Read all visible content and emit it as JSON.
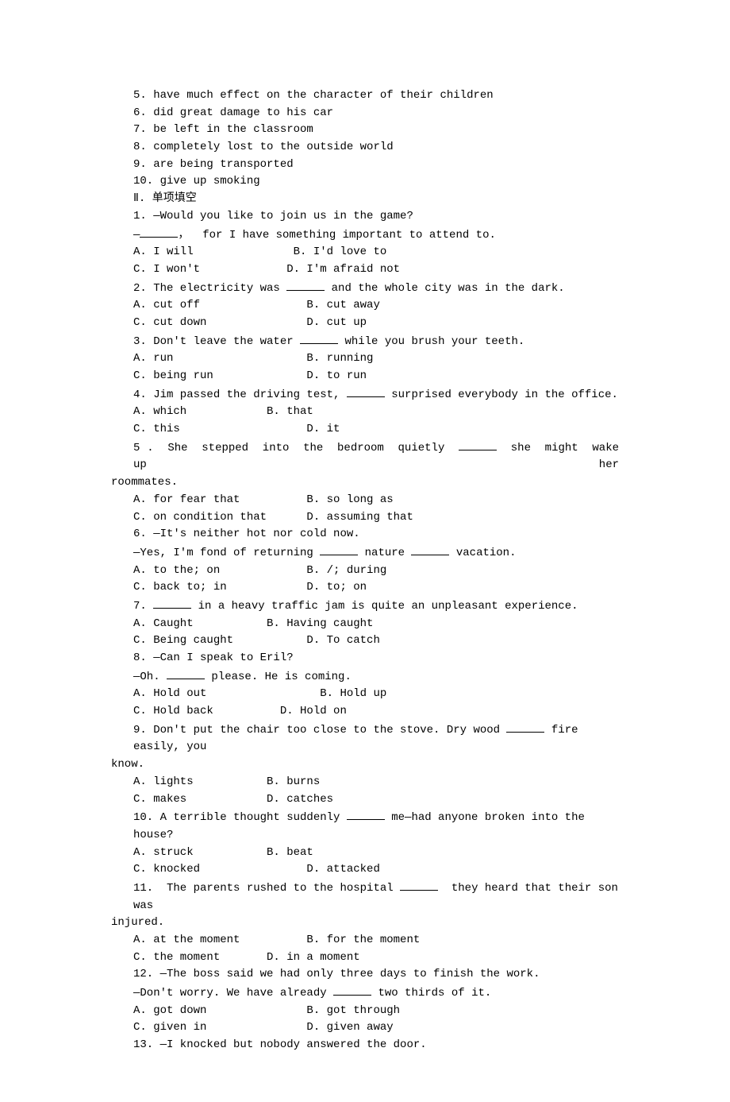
{
  "lines": [
    {
      "cls": "indent1",
      "text": "5. have much effect on the character of their children"
    },
    {
      "cls": "indent1",
      "text": "6. did great damage to his car"
    },
    {
      "cls": "indent1",
      "text": "7. be left in the classroom"
    },
    {
      "cls": "indent1",
      "text": "8. completely lost to the outside world"
    },
    {
      "cls": "indent1",
      "text": "9. are being transported"
    },
    {
      "cls": "indent1",
      "text": "10. give up smoking"
    },
    {
      "cls": "indent1",
      "text": "Ⅱ. 单项填空"
    },
    {
      "cls": "indent1",
      "text": "1. —Would you like to join us in the game?"
    },
    {
      "cls": "indent1",
      "parts": [
        "—",
        "BLANK",
        "，  for I have something important to attend to."
      ]
    },
    {
      "cls": "indent1",
      "text": "A. I will               B. I'd love to"
    },
    {
      "cls": "indent1",
      "text": "C. I won't             D. I'm afraid not"
    },
    {
      "cls": "indent1",
      "parts": [
        "2. The electricity was ",
        "BLANK",
        " and the whole city was in the dark."
      ]
    },
    {
      "cls": "indent1",
      "text": "A. cut off                B. cut away"
    },
    {
      "cls": "indent1",
      "text": "C. cut down               D. cut up"
    },
    {
      "cls": "indent1",
      "parts": [
        "3. Don't leave the water ",
        "BLANK",
        " while you brush your teeth."
      ]
    },
    {
      "cls": "indent1",
      "text": "A. run                    B. running"
    },
    {
      "cls": "indent1",
      "text": "C. being run              D. to run"
    },
    {
      "cls": "indent1",
      "parts": [
        "4. Jim passed the driving test, ",
        "BLANK",
        " surprised everybody in the office."
      ]
    },
    {
      "cls": "indent1",
      "text": "A. which            B. that"
    },
    {
      "cls": "indent1",
      "text": "C. this                   D. it"
    },
    {
      "cls": "indent1 justify",
      "parts": [
        "5 .  She  stepped  into  the  bedroom  quietly  ",
        "BLANK",
        "  she  might  wake  up  her"
      ]
    },
    {
      "cls": "wrap-indent",
      "text": "roommates."
    },
    {
      "cls": "indent1",
      "text": "A. for fear that          B. so long as"
    },
    {
      "cls": "indent1",
      "text": "C. on condition that      D. assuming that"
    },
    {
      "cls": "indent1",
      "text": "6. —It's neither hot nor cold now."
    },
    {
      "cls": "indent1",
      "parts": [
        "—Yes, I'm fond of returning ",
        "BLANK",
        " nature ",
        "BLANK",
        " vacation."
      ]
    },
    {
      "cls": "indent1",
      "text": "A. to the; on             B. /; during"
    },
    {
      "cls": "indent1",
      "text": "C. back to; in            D. to; on"
    },
    {
      "cls": "indent1",
      "parts": [
        "7. ",
        "BLANK",
        " in a heavy traffic jam is quite an unpleasant experience."
      ]
    },
    {
      "cls": "indent1",
      "text": "A. Caught           B. Having caught"
    },
    {
      "cls": "indent1",
      "text": "C. Being caught           D. To catch"
    },
    {
      "cls": "indent1",
      "text": "8. —Can I speak to Eril?"
    },
    {
      "cls": "indent1",
      "parts": [
        "—Oh. ",
        "BLANK",
        " please. He is coming."
      ]
    },
    {
      "cls": "indent1",
      "text": "A. Hold out                 B. Hold up"
    },
    {
      "cls": "indent1",
      "text": "C. Hold back          D. Hold on"
    },
    {
      "cls": "indent1",
      "parts": [
        "9. Don't put the chair too close to the stove. Dry wood ",
        "BLANK",
        " fire easily, you"
      ]
    },
    {
      "cls": "wrap-indent",
      "text": "know."
    },
    {
      "cls": "indent1",
      "text": "A. lights           B. burns"
    },
    {
      "cls": "indent1",
      "text": "C. makes            D. catches"
    },
    {
      "cls": "indent1",
      "parts": [
        "10. A terrible thought suddenly ",
        "BLANK",
        " me—had anyone broken into the house?"
      ]
    },
    {
      "cls": "indent1",
      "text": "A. struck           B. beat"
    },
    {
      "cls": "indent1",
      "text": "C. knocked                D. attacked"
    },
    {
      "cls": "indent1",
      "parts": [
        "11.  The parents rushed to the hospital ",
        "BLANK",
        "  they heard that their son was"
      ]
    },
    {
      "cls": "wrap-indent",
      "text": "injured."
    },
    {
      "cls": "indent1",
      "text": "A. at the moment          B. for the moment"
    },
    {
      "cls": "indent1",
      "text": "C. the moment       D. in a moment"
    },
    {
      "cls": "indent1",
      "text": "12. —The boss said we had only three days to finish the work."
    },
    {
      "cls": "indent1",
      "parts": [
        "—Don't worry. We have already ",
        "BLANK",
        " two thirds of it."
      ]
    },
    {
      "cls": "indent1",
      "text": "A. got down               B. got through"
    },
    {
      "cls": "indent1",
      "text": "C. given in               D. given away"
    },
    {
      "cls": "indent1",
      "text": "13. —I knocked but nobody answered the door."
    }
  ]
}
